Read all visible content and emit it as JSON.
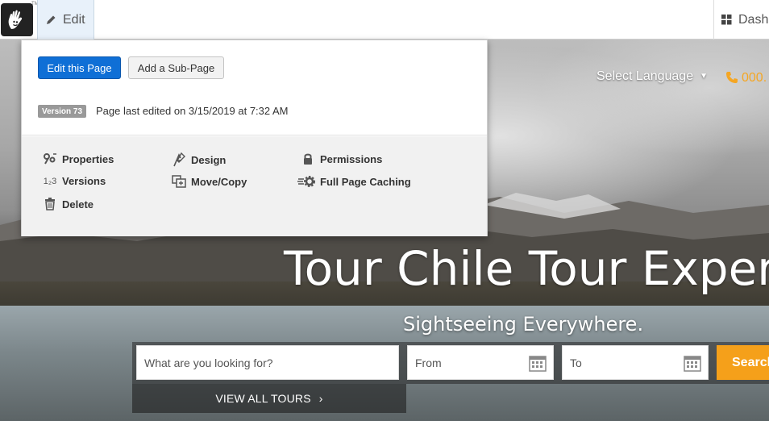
{
  "toolbar": {
    "logo_tm": "TM",
    "edit_label": "Edit",
    "dashboard_label": "Dash"
  },
  "panel": {
    "edit_page_label": "Edit this Page",
    "add_subpage_label": "Add a Sub-Page",
    "version_badge": "Version 73",
    "last_edited": "Page last edited on 3/15/2019 at 7:32 AM",
    "menu": [
      {
        "label": "Properties",
        "icon": "properties-icon"
      },
      {
        "label": "Versions",
        "icon": "versions-icon"
      },
      {
        "label": "Delete",
        "icon": "trash-icon"
      },
      {
        "label": "Design",
        "icon": "design-icon"
      },
      {
        "label": "Move/Copy",
        "icon": "move-copy-icon"
      },
      {
        "label": "Permissions",
        "icon": "lock-icon"
      },
      {
        "label": "Full Page Caching",
        "icon": "caching-icon"
      }
    ],
    "versions_icon_text": "1₂3"
  },
  "header": {
    "language_label": "Select Language",
    "phone_text": "000."
  },
  "hero": {
    "title": "Tour Chile Tour Experts",
    "subtitle": "Sightseeing Everywhere."
  },
  "search": {
    "keyword_placeholder": "What are you looking for?",
    "from_placeholder": "From",
    "to_placeholder": "To",
    "button_label": "Search",
    "view_all_label": "VIEW ALL TOURS",
    "view_all_chevron": "›"
  },
  "colors": {
    "accent_orange": "#f5a01a",
    "primary_blue": "#0f6fd6"
  }
}
